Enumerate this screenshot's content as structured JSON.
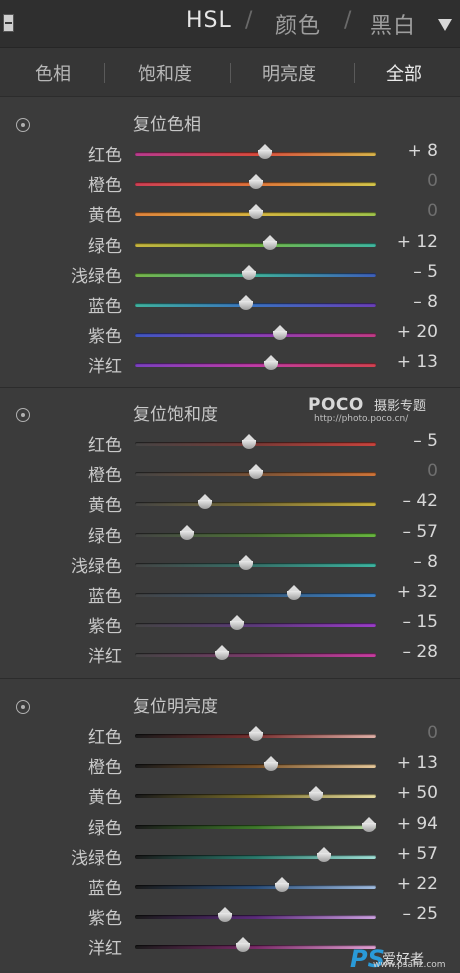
{
  "header": {
    "modes": [
      "HSL",
      "颜色",
      "黑白"
    ],
    "separators": [
      "/",
      "/"
    ]
  },
  "tabs": [
    "色相",
    "饱和度",
    "明亮度",
    "全部"
  ],
  "sections": [
    {
      "title": "复位色相",
      "rows": [
        {
          "label": "红色",
          "value": "+ 8",
          "num": 8,
          "gradient": [
            "#b93b8e",
            "#d94a3c",
            "#d8b44a"
          ]
        },
        {
          "label": "橙色",
          "value": "0",
          "num": 0,
          "gradient": [
            "#cf3e54",
            "#e07438",
            "#d3c64a"
          ]
        },
        {
          "label": "黄色",
          "value": "0",
          "num": 0,
          "gradient": [
            "#e0823b",
            "#d8b63f",
            "#9fc34b"
          ]
        },
        {
          "label": "绿色",
          "value": "+ 12",
          "num": 12,
          "gradient": [
            "#c8b43e",
            "#78b844",
            "#3eb6a0"
          ]
        },
        {
          "label": "浅绿色",
          "value": "– 5",
          "num": -5,
          "gradient": [
            "#78b548",
            "#3fb09b",
            "#3d5fba"
          ]
        },
        {
          "label": "蓝色",
          "value": "– 8",
          "num": -8,
          "gradient": [
            "#3fb29e",
            "#3a70c0",
            "#6a3fb8"
          ]
        },
        {
          "label": "紫色",
          "value": "+ 20",
          "num": 20,
          "gradient": [
            "#3f57c3",
            "#8a3fb8",
            "#c03b85"
          ]
        },
        {
          "label": "洋红",
          "value": "+ 13",
          "num": 13,
          "gradient": [
            "#7b40c0",
            "#c03ca6",
            "#d24150"
          ]
        }
      ]
    },
    {
      "title": "复位饱和度",
      "rows": [
        {
          "label": "红色",
          "value": "– 5",
          "num": -5,
          "gradient": [
            "#444444",
            "#7a3a36",
            "#c8433c"
          ]
        },
        {
          "label": "橙色",
          "value": "0",
          "num": 0,
          "gradient": [
            "#444444",
            "#7a5236",
            "#cf7438"
          ]
        },
        {
          "label": "黄色",
          "value": "– 42",
          "num": -42,
          "gradient": [
            "#444444",
            "#7a6d36",
            "#c8b03c"
          ]
        },
        {
          "label": "绿色",
          "value": "– 57",
          "num": -57,
          "gradient": [
            "#444444",
            "#4d7236",
            "#67b63e"
          ]
        },
        {
          "label": "浅绿色",
          "value": "– 8",
          "num": -8,
          "gradient": [
            "#444444",
            "#36726a",
            "#3cb4a0"
          ]
        },
        {
          "label": "蓝色",
          "value": "+ 32",
          "num": 32,
          "gradient": [
            "#444444",
            "#365a7a",
            "#3c80c8"
          ]
        },
        {
          "label": "紫色",
          "value": "– 15",
          "num": -15,
          "gradient": [
            "#444444",
            "#5c3a7a",
            "#9a3cc8"
          ]
        },
        {
          "label": "洋红",
          "value": "– 28",
          "num": -28,
          "gradient": [
            "#444444",
            "#7a3a6a",
            "#c83ca0"
          ]
        }
      ]
    },
    {
      "title": "复位明亮度",
      "rows": [
        {
          "label": "红色",
          "value": "0",
          "num": 0,
          "gradient": [
            "#1a1a1a",
            "#7a3030",
            "#e0b0a8"
          ]
        },
        {
          "label": "橙色",
          "value": "+ 13",
          "num": 13,
          "gradient": [
            "#1a1a1a",
            "#7a5228",
            "#e6c89a"
          ]
        },
        {
          "label": "黄色",
          "value": "+ 50",
          "num": 50,
          "gradient": [
            "#1a1a1a",
            "#7a6e2a",
            "#e6dca0"
          ]
        },
        {
          "label": "绿色",
          "value": "+ 94",
          "num": 94,
          "gradient": [
            "#1a1a1a",
            "#3e7a2a",
            "#b6e0a0"
          ]
        },
        {
          "label": "浅绿色",
          "value": "+ 57",
          "num": 57,
          "gradient": [
            "#1a1a1a",
            "#2a7a6c",
            "#a0e0d6"
          ]
        },
        {
          "label": "蓝色",
          "value": "+ 22",
          "num": 22,
          "gradient": [
            "#1a1a1a",
            "#2a4e7a",
            "#a0bce0"
          ]
        },
        {
          "label": "紫色",
          "value": "– 25",
          "num": -25,
          "gradient": [
            "#1a1a1a",
            "#5a2a7a",
            "#cca0e0"
          ]
        },
        {
          "label": "洋红",
          "value": "",
          "num": -10,
          "gradient": [
            "#1a1a1a",
            "#7a2a68",
            "#e0a0d2"
          ]
        }
      ]
    }
  ],
  "watermark": {
    "brand": "POCO",
    "tagline": "摄影专题",
    "url": "http://photo.poco.cn/"
  },
  "corner_logo": {
    "mark": "PS",
    "site": "爱好者",
    "url": "www.psahz.com"
  }
}
